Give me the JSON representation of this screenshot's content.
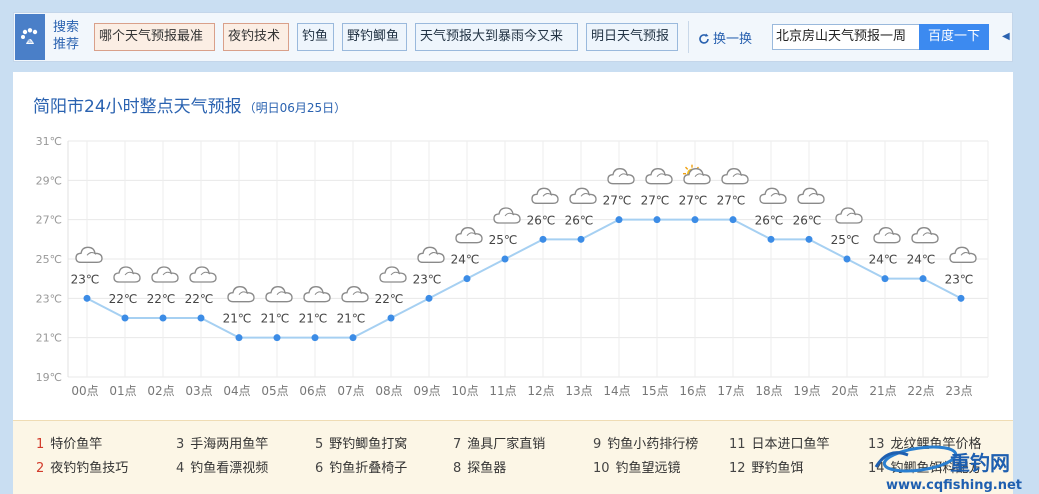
{
  "topbar": {
    "search_label": "搜索推荐",
    "tags": [
      {
        "label": "哪个天气预报最准",
        "style": "red"
      },
      {
        "label": "夜钓技术",
        "style": "red"
      },
      {
        "label": "钓鱼",
        "style": "blue"
      },
      {
        "label": "野钓鲫鱼",
        "style": "blue"
      },
      {
        "label": "天气预报大到暴雨今又来",
        "style": "blue"
      },
      {
        "label": "明日天气预报",
        "style": "blue"
      }
    ],
    "refresh_label": "换一换",
    "search_value": "北京房山天气预报一周",
    "search_button": "百度一下"
  },
  "card": {
    "title": "简阳市24小时整点天气预报",
    "subtitle": "（明日06月25日）"
  },
  "chart_data": {
    "type": "line",
    "x": [
      "00点",
      "01点",
      "02点",
      "03点",
      "04点",
      "05点",
      "06点",
      "07点",
      "08点",
      "09点",
      "10点",
      "11点",
      "12点",
      "13点",
      "14点",
      "15点",
      "16点",
      "17点",
      "18点",
      "19点",
      "20点",
      "21点",
      "22点",
      "23点"
    ],
    "temps": [
      23,
      22,
      22,
      22,
      21,
      21,
      21,
      21,
      22,
      23,
      24,
      25,
      26,
      26,
      27,
      27,
      27,
      27,
      26,
      26,
      25,
      24,
      24,
      23
    ],
    "temp_unit": "℃",
    "weather": [
      "cloudy",
      "cloudy",
      "cloudy",
      "cloudy",
      "cloudy",
      "cloudy",
      "cloudy",
      "cloudy",
      "cloudy",
      "cloudy",
      "cloudy",
      "cloudy",
      "cloudy",
      "cloudy",
      "cloudy",
      "cloudy",
      "partly-sunny",
      "cloudy",
      "cloudy",
      "cloudy",
      "cloudy",
      "cloudy",
      "cloudy",
      "cloudy"
    ],
    "yticks": [
      "31℃",
      "29℃",
      "27℃",
      "25℃",
      "23℃",
      "21℃",
      "19℃"
    ],
    "ylim": [
      19,
      31
    ],
    "grid": true,
    "line_color": "#a6d0f2",
    "point_color": "#3c8ce6"
  },
  "links": [
    {
      "num": "1",
      "text": "特价鱼竿",
      "hot": true
    },
    {
      "num": "3",
      "text": "手海两用鱼竿",
      "hot": false
    },
    {
      "num": "5",
      "text": "野钓鲫鱼打窝",
      "hot": false
    },
    {
      "num": "7",
      "text": "渔具厂家直销",
      "hot": false
    },
    {
      "num": "9",
      "text": "钓鱼小药排行榜",
      "hot": false
    },
    {
      "num": "11",
      "text": "日本进口鱼竿",
      "hot": false
    },
    {
      "num": "13",
      "text": "龙纹鲤鱼竿价格",
      "hot": false
    },
    {
      "num": "2",
      "text": "夜钓钓鱼技巧",
      "hot": true
    },
    {
      "num": "4",
      "text": "钓鱼看漂视频",
      "hot": false
    },
    {
      "num": "6",
      "text": "钓鱼折叠椅子",
      "hot": false
    },
    {
      "num": "8",
      "text": "探鱼器",
      "hot": false
    },
    {
      "num": "10",
      "text": "钓鱼望远镜",
      "hot": false
    },
    {
      "num": "12",
      "text": "野钓鱼饵",
      "hot": false
    },
    {
      "num": "14",
      "text": "钓鲫鱼饵料配方",
      "hot": false
    }
  ],
  "watermark": {
    "brand": "重钓网",
    "url": "www.cqfishing.net"
  }
}
